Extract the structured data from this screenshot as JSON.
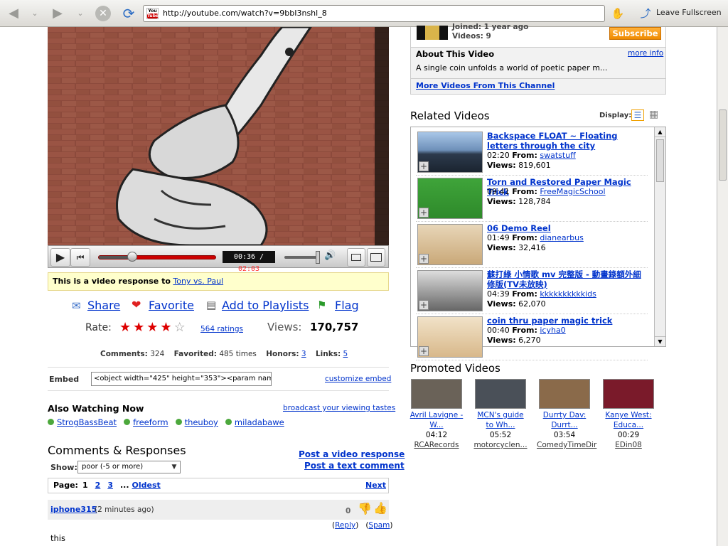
{
  "browser": {
    "url": "http://youtube.com/watch?v=9bbI3nshl_8",
    "fullscreen_label": "Leave Fullscreen",
    "favicon_top": "You",
    "favicon_bottom": "Tube"
  },
  "player": {
    "time_current": "00:36",
    "time_separator": " / ",
    "time_total": "02:03",
    "progress": 0.29
  },
  "channel": {
    "joined": "Joined: 1 year ago",
    "videos": "Videos: 9",
    "subscribe_label": "Subscribe"
  },
  "about": {
    "heading": "About This Video",
    "more_info": "more info",
    "description": "A single coin unfolds a world of poetic paper m...",
    "more_videos": "More Videos From This Channel"
  },
  "response": {
    "prefix": "This is a video response to",
    "link": "Tony vs. Paul"
  },
  "actions": {
    "share": "Share",
    "favorite": "Favorite",
    "add_to_playlists": "Add to Playlists",
    "flag": "Flag"
  },
  "rating": {
    "label": "Rate:",
    "stars": 4,
    "max_stars": 5,
    "count": "564 ratings",
    "views_label": "Views:",
    "views": "170,757"
  },
  "stats": {
    "comments_label": "Comments:",
    "comments": "324",
    "favorited_label": "Favorited:",
    "favorited": "485 times",
    "honors_label": "Honors:",
    "honors": "3",
    "links_label": "Links:",
    "links": "5"
  },
  "embed": {
    "label": "Embed",
    "code": "<object width=\"425\" height=\"353\"><param name",
    "customize": "customize embed"
  },
  "also_watching": {
    "heading": "Also Watching Now",
    "broadcast": "broadcast your viewing tastes",
    "users": [
      "StrogBassBeat",
      "freeform",
      "theuboy",
      "miladabawe"
    ]
  },
  "comments": {
    "heading": "Comments & Responses",
    "post_video": "Post a video response",
    "post_text": "Post a text comment",
    "show_label": "Show:",
    "show_value": "poor (-5 or more)",
    "page_label": "Page:",
    "pages": [
      "1",
      "2",
      "3"
    ],
    "ellipsis": "...",
    "oldest": "Oldest",
    "next": "Next",
    "first": {
      "user": "iphone315",
      "time": "(2 minutes ago)",
      "score": "0",
      "reply": "Reply",
      "spam": "Spam",
      "text": "this"
    }
  },
  "related": {
    "heading": "Related Videos",
    "display_label": "Display:",
    "from_label": "From:",
    "views_label": "Views:",
    "items": [
      {
        "title": "Backspace FLOAT ~ Floating letters through the city",
        "duration": "02:20",
        "from": "swatstuff",
        "views": "819,601"
      },
      {
        "title": "Torn and Restored Paper Magic Trick",
        "duration": "09:41",
        "from": "FreeMagicSchool",
        "views": "128,784"
      },
      {
        "title": "06 Demo Reel",
        "duration": "01:49",
        "from": "dianearbus",
        "views": "32,416"
      },
      {
        "title": "蘇打綠 小情歌 mv 完整版 - 動畫錄額外細修版(TV未放映)",
        "duration": "04:39",
        "from": "kkkkkkkkkkids",
        "views": "62,070"
      },
      {
        "title": "coin thru paper magic trick",
        "duration": "00:40",
        "from": "icyha0",
        "views": "6,270"
      }
    ]
  },
  "promoted": {
    "heading": "Promoted Videos",
    "items": [
      {
        "title": "Avril Lavigne - W...",
        "duration": "04:12",
        "channel": "RCARecords"
      },
      {
        "title": "MCN's guide to Wh...",
        "duration": "05:52",
        "channel": "motorcyclen..."
      },
      {
        "title": "Durrty Dav: Durrt...",
        "duration": "03:54",
        "channel": "ComedyTimeDir"
      },
      {
        "title": "Kanye West: Educa...",
        "duration": "00:29",
        "channel": "EDin08"
      }
    ]
  },
  "colors": {
    "link": "#0033cc",
    "subscribe": "#f39200",
    "progress": "#cc0000",
    "response_bg": "#ffffcc"
  }
}
